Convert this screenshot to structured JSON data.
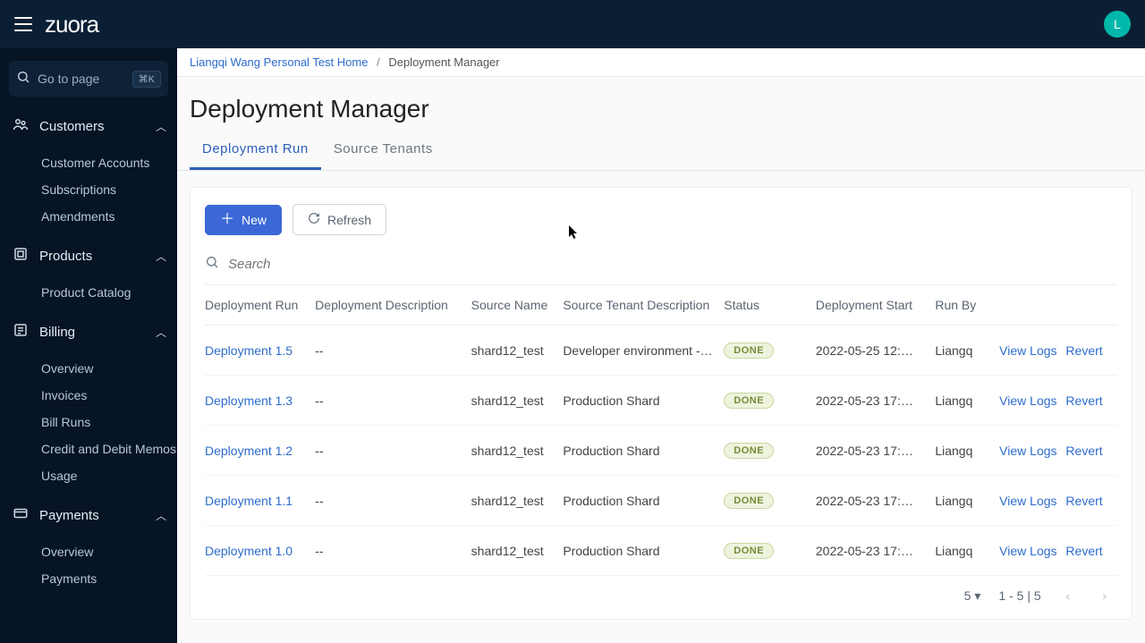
{
  "topbar": {
    "logo": "zuora",
    "avatar_initial": "L"
  },
  "sidebar": {
    "search_placeholder": "Go to page",
    "search_shortcut": "⌘K",
    "sections": [
      {
        "label": "Customers",
        "items": [
          "Customer Accounts",
          "Subscriptions",
          "Amendments"
        ]
      },
      {
        "label": "Products",
        "items": [
          "Product Catalog"
        ]
      },
      {
        "label": "Billing",
        "items": [
          "Overview",
          "Invoices",
          "Bill Runs",
          "Credit and Debit Memos",
          "Usage"
        ]
      },
      {
        "label": "Payments",
        "items": [
          "Overview",
          "Payments"
        ]
      }
    ]
  },
  "breadcrumb": {
    "home": "Liangqi Wang Personal Test Home",
    "current": "Deployment Manager"
  },
  "page": {
    "title": "Deployment Manager"
  },
  "tabs": [
    {
      "label": "Deployment Run",
      "active": true
    },
    {
      "label": "Source Tenants",
      "active": false
    }
  ],
  "buttons": {
    "new": "New",
    "refresh": "Refresh"
  },
  "table": {
    "search_placeholder": "Search",
    "columns": [
      "Deployment Run",
      "Deployment Description",
      "Source Name",
      "Source Tenant Description",
      "Status",
      "Deployment Start",
      "Run By",
      "",
      ""
    ],
    "rows": [
      {
        "name": "Deployment 1.5",
        "desc": "--",
        "src": "shard12_test",
        "tenant": "Developer environment -…",
        "status": "DONE",
        "start": "2022-05-25 12:…",
        "runby": "Liangq",
        "a1": "View Logs",
        "a2": "Revert"
      },
      {
        "name": "Deployment 1.3",
        "desc": "--",
        "src": "shard12_test",
        "tenant": "Production Shard",
        "status": "DONE",
        "start": "2022-05-23 17:…",
        "runby": "Liangq",
        "a1": "View Logs",
        "a2": "Revert"
      },
      {
        "name": "Deployment 1.2",
        "desc": "--",
        "src": "shard12_test",
        "tenant": "Production Shard",
        "status": "DONE",
        "start": "2022-05-23 17:…",
        "runby": "Liangq",
        "a1": "View Logs",
        "a2": "Revert"
      },
      {
        "name": "Deployment 1.1",
        "desc": "--",
        "src": "shard12_test",
        "tenant": "Production Shard",
        "status": "DONE",
        "start": "2022-05-23 17:…",
        "runby": "Liangq",
        "a1": "View Logs",
        "a2": "Revert"
      },
      {
        "name": "Deployment 1.0",
        "desc": "--",
        "src": "shard12_test",
        "tenant": "Production Shard",
        "status": "DONE",
        "start": "2022-05-23 17:…",
        "runby": "Liangq",
        "a1": "View Logs",
        "a2": "Revert"
      }
    ]
  },
  "pager": {
    "page_size": "5",
    "range": "1 - 5 | 5"
  }
}
